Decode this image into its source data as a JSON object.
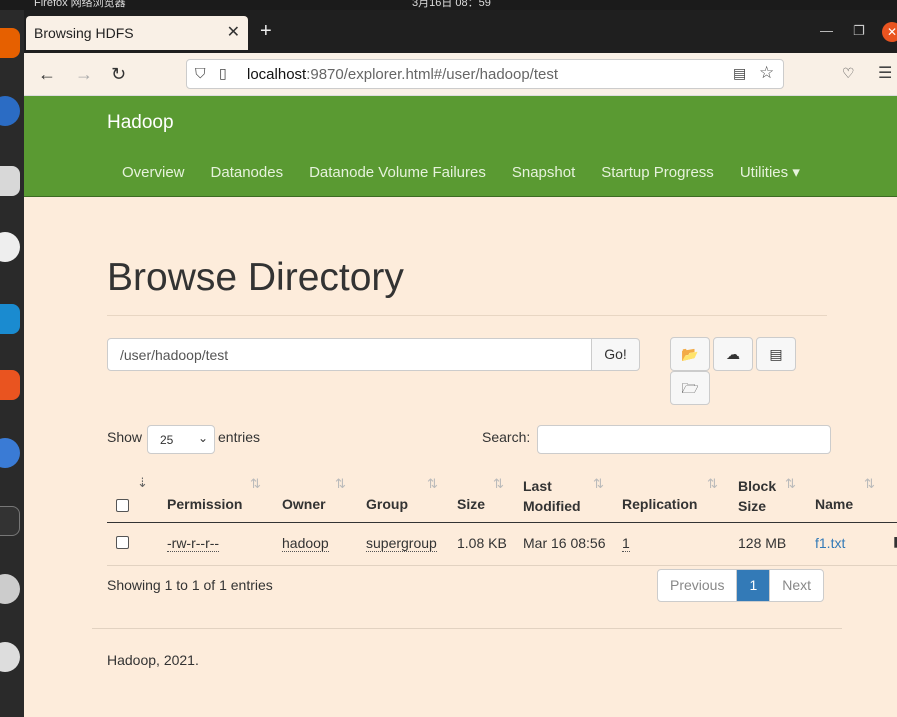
{
  "os": {
    "app_name": "Firefox 网络浏览器",
    "clock": "3月16日 08：59"
  },
  "browser": {
    "tab_title": "Browsing HDFS",
    "url_host": "localhost",
    "url_rest": ":9870/explorer.html#/user/hadoop/test"
  },
  "nav": {
    "brand": "Hadoop",
    "items": [
      "Overview",
      "Datanodes",
      "Datanode Volume Failures",
      "Snapshot",
      "Startup Progress",
      "Utilities ▾"
    ]
  },
  "main": {
    "heading": "Browse Directory",
    "path_value": "/user/hadoop/test",
    "go_label": "Go!",
    "show_label": "Show",
    "page_length": "25",
    "entries_label": "entries",
    "search_label": "Search:"
  },
  "table": {
    "headers": [
      "Permission",
      "Owner",
      "Group",
      "Size",
      "Last Modified",
      "Replication",
      "Block Size",
      "Name"
    ],
    "rows": [
      {
        "permission": "-rw-r--r--",
        "owner": "hadoop",
        "group": "supergroup",
        "size": "1.08 KB",
        "modified": "Mar 16 08:56",
        "replication": "1",
        "block_size": "128 MB",
        "name": "f1.txt"
      }
    ]
  },
  "pagination": {
    "info": "Showing 1 to 1 of 1 entries",
    "prev": "Previous",
    "current": "1",
    "next": "Next"
  },
  "footer": "Hadoop, 2021.",
  "colors": {
    "nav_green": "#5a9a32",
    "page_bg": "#fdecdb",
    "link_blue": "#337ab7"
  }
}
